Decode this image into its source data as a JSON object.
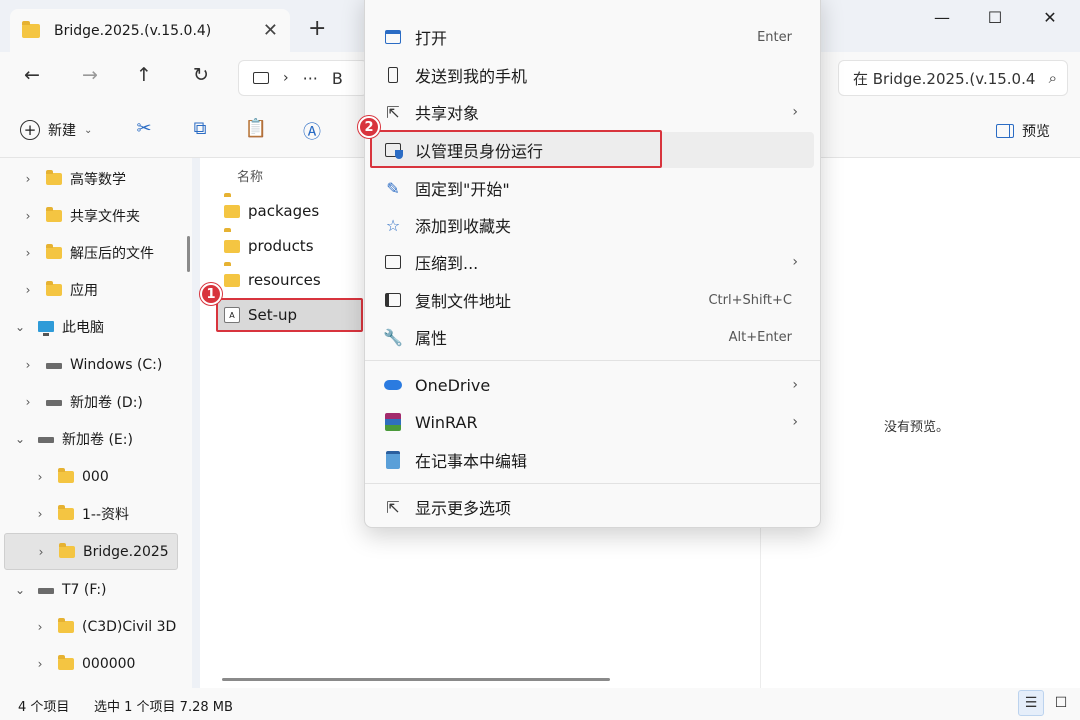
{
  "window": {
    "tab_title": "Bridge.2025.(v.15.0.4)",
    "tab_close": "✕",
    "new_tab": "+",
    "minimize": "—",
    "maximize": "☐",
    "close": "✕"
  },
  "nav": {
    "back": "←",
    "forward": "→",
    "up": "↑",
    "refresh": "↻",
    "address_more": "···",
    "address_partial": "B",
    "search_placeholder": "在 Bridge.2025.(v.15.0.4",
    "search_icon": "⌕"
  },
  "toolbar": {
    "new_label": "新建",
    "preview_label": "预览"
  },
  "sidebar": {
    "items": [
      {
        "label": "高等数学",
        "icon": "folder"
      },
      {
        "label": "共享文件夹",
        "icon": "folder"
      },
      {
        "label": "解压后的文件",
        "icon": "folder"
      },
      {
        "label": "应用",
        "icon": "folder"
      },
      {
        "label": "此电脑",
        "icon": "pc"
      },
      {
        "label": "Windows (C:)",
        "icon": "drive"
      },
      {
        "label": "新加卷 (D:)",
        "icon": "drive"
      },
      {
        "label": "新加卷 (E:)",
        "icon": "drive"
      },
      {
        "label": "000",
        "icon": "folder"
      },
      {
        "label": "1--资料",
        "icon": "folder"
      },
      {
        "label": "Bridge.2025",
        "icon": "folder"
      },
      {
        "label": "T7 (F:)",
        "icon": "drive"
      },
      {
        "label": "(C3D)Civil 3D",
        "icon": "folder"
      },
      {
        "label": "000000",
        "icon": "folder"
      }
    ]
  },
  "filelist": {
    "column_name": "名称",
    "files": [
      {
        "label": "packages",
        "icon": "folder"
      },
      {
        "label": "products",
        "icon": "folder"
      },
      {
        "label": "resources",
        "icon": "folder"
      },
      {
        "label": "Set-up",
        "icon": "setup"
      }
    ]
  },
  "preview": {
    "no_preview": "没有预览。"
  },
  "status": {
    "item_count": "4 个项目",
    "selection": "选中 1 个项目  7.28 MB"
  },
  "badges": {
    "step1": "1",
    "step2": "2"
  },
  "context_menu": {
    "items": [
      {
        "label": "打开",
        "shortcut": "Enter",
        "icon": "open-icon"
      },
      {
        "label": "发送到我的手机",
        "shortcut": "",
        "icon": "phone-icon"
      },
      {
        "label": "共享对象",
        "shortcut": "",
        "icon": "share-icon",
        "submenu": true
      },
      {
        "label": "以管理员身份运行",
        "shortcut": "",
        "icon": "shield-icon"
      },
      {
        "label": "固定到\"开始\"",
        "shortcut": "",
        "icon": "pin-icon"
      },
      {
        "label": "添加到收藏夹",
        "shortcut": "",
        "icon": "star-icon"
      },
      {
        "label": "压缩到...",
        "shortcut": "",
        "icon": "zip-icon",
        "submenu": true
      },
      {
        "label": "复制文件地址",
        "shortcut": "Ctrl+Shift+C",
        "icon": "copy-path-icon"
      },
      {
        "label": "属性",
        "shortcut": "Alt+Enter",
        "icon": "wrench-icon"
      },
      {
        "label": "OneDrive",
        "shortcut": "",
        "icon": "cloud-icon",
        "submenu": true
      },
      {
        "label": "WinRAR",
        "shortcut": "",
        "icon": "winrar-icon",
        "submenu": true
      },
      {
        "label": "在记事本中编辑",
        "shortcut": "",
        "icon": "notepad-icon"
      },
      {
        "label": "显示更多选项",
        "shortcut": "",
        "icon": "more-options-icon"
      }
    ],
    "submenu_arrow": "›"
  },
  "colors": {
    "highlight": "#d8343d",
    "folder": "#f4c542",
    "accent": "#2b6cc4"
  }
}
